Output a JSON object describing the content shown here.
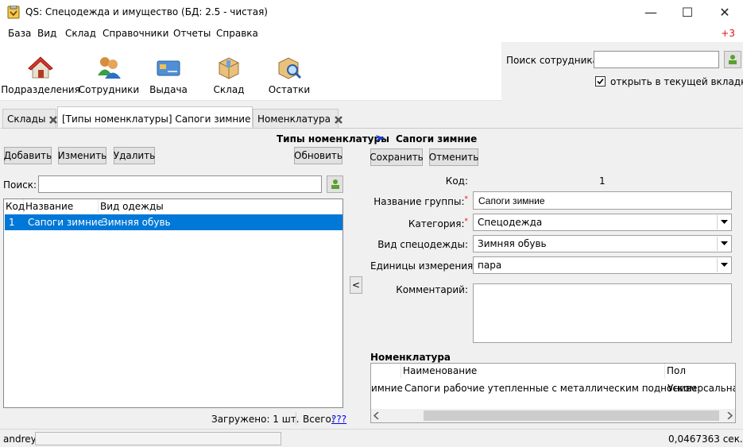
{
  "window": {
    "title": "QS: Спецодежда и имущество (БД: 2.5 - чистая)",
    "minimize": "—",
    "maximize": "☐",
    "close": "✕"
  },
  "menu": {
    "items": [
      "База",
      "Вид",
      "Склад",
      "Справочники",
      "Отчеты",
      "Справка"
    ],
    "notification": "+3"
  },
  "toolbar": {
    "buttons": [
      "Подразделения",
      "Сотрудники",
      "Выдача",
      "Склад",
      "Остатки"
    ]
  },
  "employee_search": {
    "label": "Поиск сотрудника:",
    "value": "",
    "open_in_tab_label": "открыть в текущей вкладке",
    "open_in_tab_checked": true
  },
  "tabs": [
    {
      "label": "Склады",
      "active": false
    },
    {
      "label": "[Типы номенклатуры]  Сапоги зимние",
      "active": true
    },
    {
      "label": "Номенклатура",
      "active": false
    }
  ],
  "breadcrumb": {
    "parent": "Типы номенклатуры",
    "current": "Сапоги зимние"
  },
  "list_panel": {
    "add": "Добавить",
    "edit": "Изменить",
    "delete": "Удалить",
    "refresh": "Обновить",
    "search_label": "Поиск:",
    "search_value": "",
    "columns": [
      "Код",
      "Название",
      "Вид одежды"
    ],
    "rows": [
      {
        "code": "1",
        "name": "Сапоги зимние",
        "kind": "Зимняя обувь",
        "selected": true
      }
    ],
    "loaded": "Загружено: 1 шт.",
    "total_label": "Всего:",
    "total_value": "???",
    "collapse": "<"
  },
  "form": {
    "save": "Сохранить",
    "cancel": "Отменить",
    "code_label": "Код:",
    "code_value": "1",
    "group_name_label": "Название группы:",
    "group_name_value": "Сапоги зимние",
    "category_label": "Категория:",
    "category_value": "Спецодежда",
    "kind_label": "Вид спецодежды:",
    "kind_value": "Зимняя обувь",
    "units_label": "Единицы измерения:",
    "units_value": "пара",
    "comment_label": "Комментарий:",
    "comment_value": "",
    "required_mark": "*"
  },
  "nomenclature": {
    "title": "Номенклатура",
    "columns": [
      "",
      "Наименование",
      "Пол"
    ],
    "rows": [
      {
        "c0": "имние",
        "name": "Сапоги рабочие утепленные с металлическим подноском",
        "gender": "Универсальная"
      }
    ]
  },
  "status": {
    "user": "andrey",
    "time": "0,0467363 сек."
  },
  "colors": {
    "selection": "#0078d7",
    "required": "#e01010",
    "link": "#0000ee",
    "accent": "#1e3fd6"
  }
}
